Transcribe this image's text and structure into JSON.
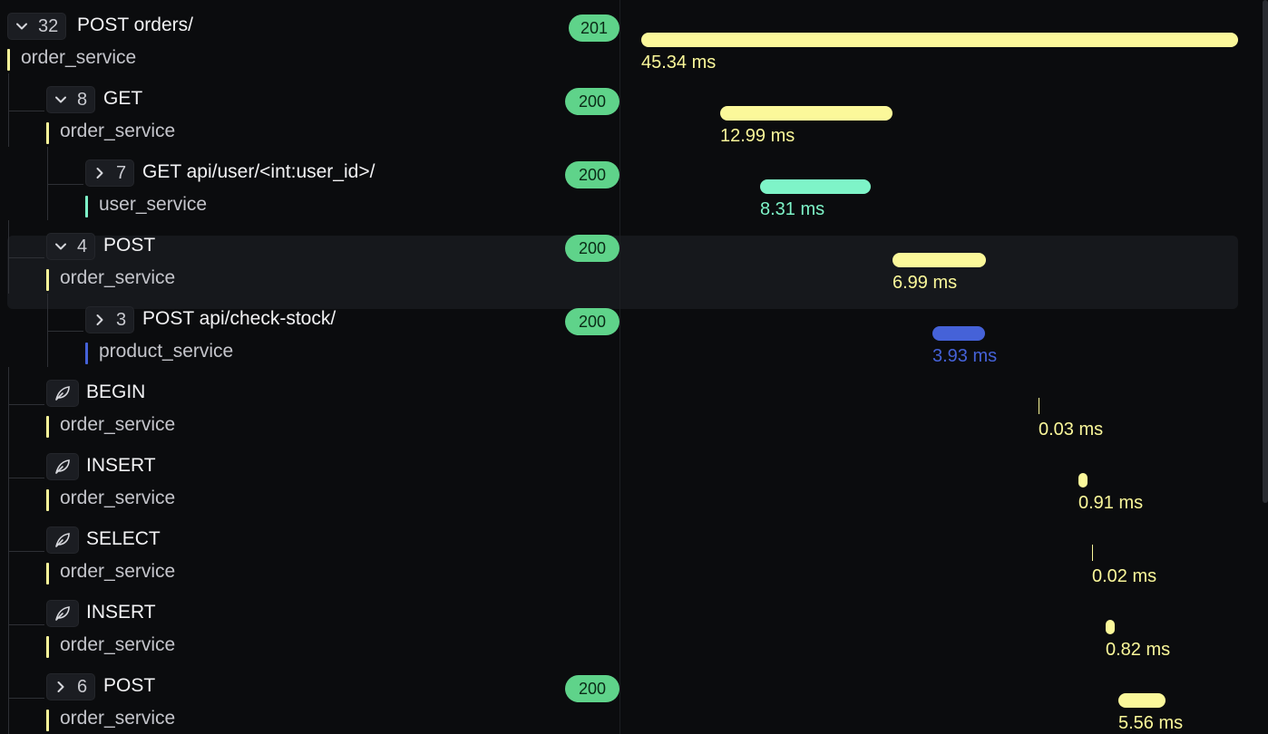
{
  "colors": {
    "order_service": "#fbf89a",
    "user_service": "#7ef4c8",
    "product_service": "#4562d8"
  },
  "spans": [
    {
      "count": "32",
      "expanded": true,
      "name": "POST orders/",
      "service": "order_service",
      "status": "201",
      "duration": "45.34 ms"
    },
    {
      "count": "8",
      "expanded": true,
      "name": "GET",
      "service": "order_service",
      "status": "200",
      "duration": "12.99 ms"
    },
    {
      "count": "7",
      "expanded": false,
      "name": "GET api/user/<int:user_id>/",
      "service": "user_service",
      "status": "200",
      "duration": "8.31 ms"
    },
    {
      "count": "4",
      "expanded": true,
      "name": "POST",
      "service": "order_service",
      "status": "200",
      "duration": "6.99 ms"
    },
    {
      "count": "3",
      "expanded": false,
      "name": "POST api/check-stock/",
      "service": "product_service",
      "status": "200",
      "duration": "3.93 ms"
    },
    {
      "icon": "leaf-icon",
      "name": "BEGIN",
      "service": "order_service",
      "duration": "0.03 ms"
    },
    {
      "icon": "leaf-icon",
      "name": "INSERT",
      "service": "order_service",
      "duration": "0.91 ms"
    },
    {
      "icon": "leaf-icon",
      "name": "SELECT",
      "service": "order_service",
      "duration": "0.02 ms"
    },
    {
      "icon": "leaf-icon",
      "name": "INSERT",
      "service": "order_service",
      "duration": "0.82 ms"
    },
    {
      "count": "6",
      "expanded": false,
      "name": "POST",
      "service": "order_service",
      "status": "200",
      "duration": "5.56 ms"
    }
  ]
}
